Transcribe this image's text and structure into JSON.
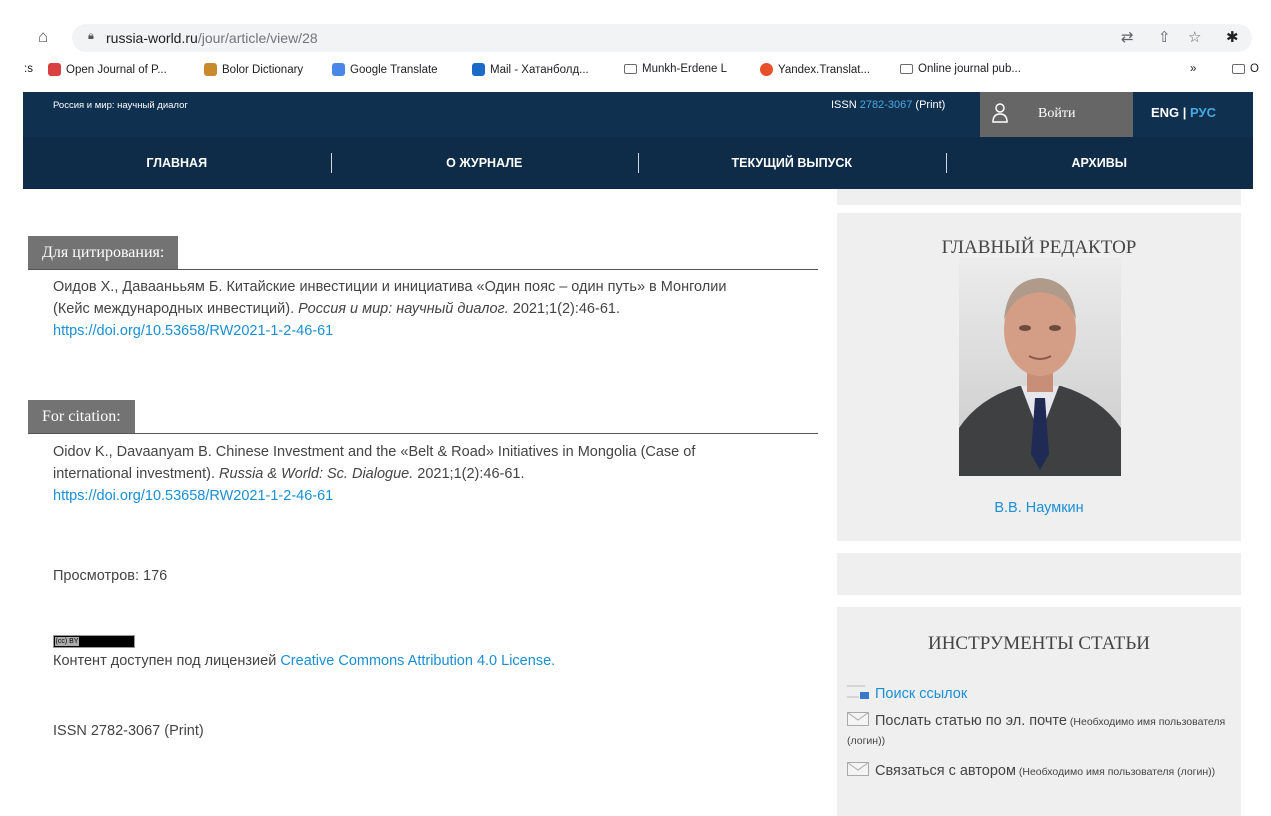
{
  "browser": {
    "url_host": "russia-world.ru",
    "url_path": "/jour/article/view/28",
    "bookmarks_left_edge": ":s",
    "bookmarks": [
      {
        "label": "Open Journal of P...",
        "icon": "ojp-icon",
        "color": "#d94040"
      },
      {
        "label": "Bolor Dictionary",
        "icon": "bolor-icon",
        "color": "#c98a2b"
      },
      {
        "label": "Google Translate",
        "icon": "google-translate-icon",
        "color": "#4a86e8"
      },
      {
        "label": "Mail - Хатанболд...",
        "icon": "outlook-icon",
        "color": "#1a6ac7"
      },
      {
        "label": "Munkh-Erdene L",
        "icon": "folder-icon",
        "color": "#666666"
      },
      {
        "label": "Yandex.Translat...",
        "icon": "yandex-icon",
        "color": "#e8502a"
      },
      {
        "label": "Online journal pub...",
        "icon": "folder-icon",
        "color": "#666666"
      }
    ],
    "more_label": "»",
    "other_label": "O"
  },
  "site": {
    "title": "Россия и мир: научный диалог",
    "issn_prefix": "ISSN ",
    "issn_number": "2782-3067",
    "issn_suffix": " (Print)",
    "login": "Войти",
    "lang_eng": "ENG",
    "lang_sep": " | ",
    "lang_rus": "РУС",
    "nav": [
      "ГЛАВНАЯ",
      "О ЖУРНАЛЕ",
      "ТЕКУЩИЙ ВЫПУСК",
      "АРХИВЫ"
    ]
  },
  "main": {
    "cite_ru_label": "Для цитирования:",
    "cite_ru_line1": "Оидов Х., Даваанььям Б. Китайские инвестиции и инициатива «Один пояс – один путь» в Монголии",
    "cite_ru_line2a": "(Кейс международных инвестиций). ",
    "cite_ru_journal": "Россия и мир: научный диалог.",
    "cite_ru_line2b": " 2021;1(2):46-61.",
    "doi": "https://doi.org/10.53658/RW2021-1-2-46-61",
    "cite_en_label": "For citation:",
    "cite_en_line1": "Oidov K., Davaanyam B. Chinese Investment and the «Belt & Road» Initiatives in Mongolia (Case of",
    "cite_en_line2a": "international investment). ",
    "cite_en_journal": "Russia & World: Sc. Dialogue.",
    "cite_en_line2b": " 2021;1(2):46-61.",
    "views": "Просмотров: 176",
    "cc_small": "(cc) BY",
    "license_prefix": "Контент доступен под лицензией ",
    "license_link": "Creative Commons Attribution 4.0 License.",
    "issn_footer": "ISSN 2782-3067 (Print)"
  },
  "sidebar": {
    "editor_heading": "ГЛАВНЫЙ РЕДАКТОР",
    "editor_name": "В.В. Наумкин",
    "tools_heading": "ИНСТРУМЕНТЫ СТАТЬИ",
    "tool_search": "Поиск ссылок",
    "tool_email_main": "Послать статью по эл. почте",
    "tool_email_note": " (Необходимо имя пользователя (логин))",
    "tool_contact_main": "Связаться с автором",
    "tool_contact_note": " (Необходимо имя пользователя (логин))"
  }
}
